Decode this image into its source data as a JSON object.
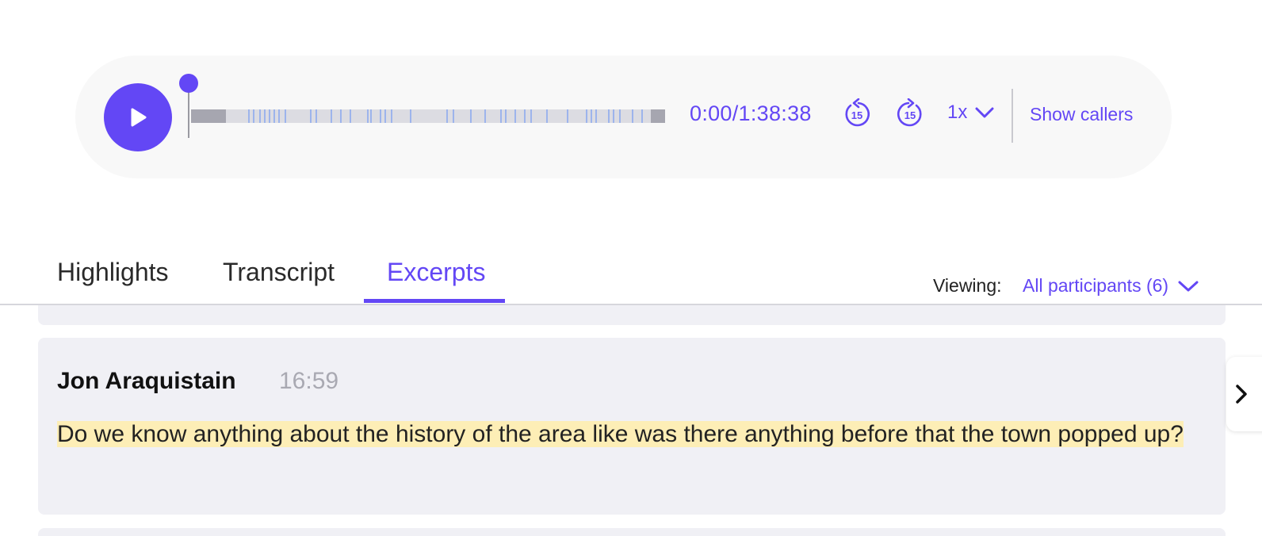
{
  "player": {
    "time_display": "0:00/1:38:38",
    "progress": 0,
    "skip_back_label": "15",
    "skip_forward_label": "15",
    "speed": "1x",
    "show_callers_label": "Show callers"
  },
  "tabs": [
    {
      "label": "Highlights",
      "active": false
    },
    {
      "label": "Transcript",
      "active": false
    },
    {
      "label": "Excerpts",
      "active": true
    }
  ],
  "viewing": {
    "label": "Viewing:",
    "value": "All participants (6)"
  },
  "excerpts": [
    {
      "speaker": "Jon Araquistain",
      "timestamp": "16:59",
      "text": "Do we know anything about the history of the area like was there anything before that the town popped up?"
    }
  ],
  "colors": {
    "accent": "#6347f5",
    "highlight": "#fdeeb6",
    "card_bg": "#f0f0f5",
    "player_bg": "#f8f8f8"
  },
  "icons": [
    "play-icon",
    "skip-back-15-icon",
    "skip-forward-15-icon",
    "chevron-down-icon",
    "chevron-right-icon"
  ]
}
